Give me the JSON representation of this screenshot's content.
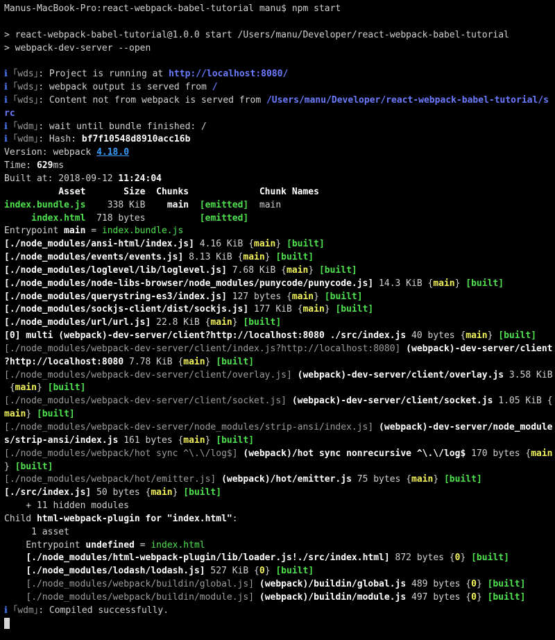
{
  "terminal": {
    "lines": [
      [
        {
          "t": "Manus-MacBook-Pro:react-webpack-babel-tutorial manu$ npm start"
        }
      ],
      [],
      [
        {
          "t": "> react-webpack-babel-tutorial@1.0.0 start /Users/manu/Developer/react-webpack-babel-tutorial"
        }
      ],
      [
        {
          "t": "> webpack-dev-server --open"
        }
      ],
      [],
      [
        {
          "t": "ℹ ",
          "c": "info"
        },
        {
          "t": "｢wds｣",
          "c": "dim"
        },
        {
          "t": ": Project is running at "
        },
        {
          "t": "http://localhost:8080/",
          "c": "bl"
        }
      ],
      [
        {
          "t": "ℹ ",
          "c": "info"
        },
        {
          "t": "｢wds｣",
          "c": "dim"
        },
        {
          "t": ": webpack output is served from "
        },
        {
          "t": "/",
          "c": "bl"
        }
      ],
      [
        {
          "t": "ℹ ",
          "c": "info"
        },
        {
          "t": "｢wds｣",
          "c": "dim"
        },
        {
          "t": ": Content not from webpack is served from "
        },
        {
          "t": "/Users/manu/Developer/react-webpack-babel-tutorial/s",
          "c": "bl"
        }
      ],
      [
        {
          "t": "rc",
          "c": "bl"
        }
      ],
      [
        {
          "t": "ℹ ",
          "c": "info"
        },
        {
          "t": "｢wdm｣",
          "c": "dim"
        },
        {
          "t": ": wait until bundle finished: /"
        }
      ],
      [
        {
          "t": "ℹ ",
          "c": "info"
        },
        {
          "t": "｢wdm｣",
          "c": "dim"
        },
        {
          "t": ": Hash: "
        },
        {
          "t": "bf7f10548d8910acc16b",
          "c": "w"
        }
      ],
      [
        {
          "t": "Version: webpack "
        },
        {
          "t": "4.18.0",
          "c": "ul"
        }
      ],
      [
        {
          "t": "Time: "
        },
        {
          "t": "629",
          "c": "w"
        },
        {
          "t": "ms"
        }
      ],
      [
        {
          "t": "Built at: 2018-09-12 "
        },
        {
          "t": "11:24:04",
          "c": "w"
        }
      ],
      [
        {
          "t": "          Asset       Size  Chunks             Chunk Names",
          "c": "w"
        }
      ],
      [
        {
          "t": "index.bundle.js",
          "c": "gb"
        },
        {
          "t": "    338 KiB    "
        },
        {
          "t": "main",
          "c": "w"
        },
        {
          "t": "  "
        },
        {
          "t": "[emitted]",
          "c": "gb"
        },
        {
          "t": "  main"
        }
      ],
      [
        {
          "t": "     "
        },
        {
          "t": "index.html",
          "c": "gb"
        },
        {
          "t": "  718 bytes          "
        },
        {
          "t": "[emitted]",
          "c": "gb"
        }
      ],
      [
        {
          "t": "Entrypoint "
        },
        {
          "t": "main",
          "c": "w"
        },
        {
          "t": " = "
        },
        {
          "t": "index.bundle.js",
          "c": "g"
        }
      ],
      [
        {
          "t": "[./node_modules/ansi-html/index.js]",
          "c": "w"
        },
        {
          "t": " 4.16 KiB {"
        },
        {
          "t": "main",
          "c": "y"
        },
        {
          "t": "} "
        },
        {
          "t": "[built]",
          "c": "gb"
        }
      ],
      [
        {
          "t": "[./node_modules/events/events.js]",
          "c": "w"
        },
        {
          "t": " 8.13 KiB {"
        },
        {
          "t": "main",
          "c": "y"
        },
        {
          "t": "} "
        },
        {
          "t": "[built]",
          "c": "gb"
        }
      ],
      [
        {
          "t": "[./node_modules/loglevel/lib/loglevel.js]",
          "c": "w"
        },
        {
          "t": " 7.68 KiB {"
        },
        {
          "t": "main",
          "c": "y"
        },
        {
          "t": "} "
        },
        {
          "t": "[built]",
          "c": "gb"
        }
      ],
      [
        {
          "t": "[./node_modules/node-libs-browser/node_modules/punycode/punycode.js]",
          "c": "w"
        },
        {
          "t": " 14.3 KiB {"
        },
        {
          "t": "main",
          "c": "y"
        },
        {
          "t": "} "
        },
        {
          "t": "[built]",
          "c": "gb"
        }
      ],
      [
        {
          "t": "[./node_modules/querystring-es3/index.js]",
          "c": "w"
        },
        {
          "t": " 127 bytes {"
        },
        {
          "t": "main",
          "c": "y"
        },
        {
          "t": "} "
        },
        {
          "t": "[built]",
          "c": "gb"
        }
      ],
      [
        {
          "t": "[./node_modules/sockjs-client/dist/sockjs.js]",
          "c": "w"
        },
        {
          "t": " 177 KiB {"
        },
        {
          "t": "main",
          "c": "y"
        },
        {
          "t": "} "
        },
        {
          "t": "[built]",
          "c": "gb"
        }
      ],
      [
        {
          "t": "[./node_modules/url/url.js]",
          "c": "w"
        },
        {
          "t": " 22.8 KiB {"
        },
        {
          "t": "main",
          "c": "y"
        },
        {
          "t": "} "
        },
        {
          "t": "[built]",
          "c": "gb"
        }
      ],
      [
        {
          "t": "[0] multi (webpack)-dev-server/client?http://localhost:8080 ./src/index.js",
          "c": "w"
        },
        {
          "t": " 40 bytes {"
        },
        {
          "t": "main",
          "c": "y"
        },
        {
          "t": "} "
        },
        {
          "t": "[built]",
          "c": "gb"
        }
      ],
      [
        {
          "t": "[./node_modules/webpack-dev-server/client/index.js?http://localhost:8080]",
          "c": "dim"
        },
        {
          "t": " (webpack)-dev-server/client",
          "c": "w"
        }
      ],
      [
        {
          "t": "?http://localhost:8080",
          "c": "w"
        },
        {
          "t": " 7.78 KiB {"
        },
        {
          "t": "main",
          "c": "y"
        },
        {
          "t": "} "
        },
        {
          "t": "[built]",
          "c": "gb"
        }
      ],
      [
        {
          "t": "[./node_modules/webpack-dev-server/client/overlay.js]",
          "c": "dim"
        },
        {
          "t": " (webpack)-dev-server/client/overlay.js",
          "c": "w"
        },
        {
          "t": " 3.58 KiB"
        }
      ],
      [
        {
          "t": " {"
        },
        {
          "t": "main",
          "c": "y"
        },
        {
          "t": "} "
        },
        {
          "t": "[built]",
          "c": "gb"
        }
      ],
      [
        {
          "t": "[./node_modules/webpack-dev-server/client/socket.js]",
          "c": "dim"
        },
        {
          "t": " (webpack)-dev-server/client/socket.js",
          "c": "w"
        },
        {
          "t": " 1.05 KiB {"
        }
      ],
      [
        {
          "t": "main",
          "c": "y"
        },
        {
          "t": "} "
        },
        {
          "t": "[built]",
          "c": "gb"
        }
      ],
      [
        {
          "t": "[./node_modules/webpack-dev-server/node_modules/strip-ansi/index.js]",
          "c": "dim"
        },
        {
          "t": " (webpack)-dev-server/node_module",
          "c": "w"
        }
      ],
      [
        {
          "t": "s/strip-ansi/index.js",
          "c": "w"
        },
        {
          "t": " 161 bytes {"
        },
        {
          "t": "main",
          "c": "y"
        },
        {
          "t": "} "
        },
        {
          "t": "[built]",
          "c": "gb"
        }
      ],
      [
        {
          "t": "[./node_modules/webpack/hot sync ^\\.\\/log$]",
          "c": "dim"
        },
        {
          "t": " (webpack)/hot sync nonrecursive ^\\.\\/log$",
          "c": "w"
        },
        {
          "t": " 170 bytes {"
        },
        {
          "t": "main",
          "c": "y"
        }
      ],
      [
        {
          "t": "} "
        },
        {
          "t": "[built]",
          "c": "gb"
        }
      ],
      [
        {
          "t": "[./node_modules/webpack/hot/emitter.js]",
          "c": "dim"
        },
        {
          "t": " (webpack)/hot/emitter.js",
          "c": "w"
        },
        {
          "t": " 75 bytes {"
        },
        {
          "t": "main",
          "c": "y"
        },
        {
          "t": "} "
        },
        {
          "t": "[built]",
          "c": "gb"
        }
      ],
      [
        {
          "t": "[./src/index.js]",
          "c": "w"
        },
        {
          "t": " 50 bytes {"
        },
        {
          "t": "main",
          "c": "y"
        },
        {
          "t": "} "
        },
        {
          "t": "[built]",
          "c": "gb"
        }
      ],
      [
        {
          "t": "    + 11 hidden modules"
        }
      ],
      [
        {
          "t": "Child "
        },
        {
          "t": "html-webpack-plugin for \"index.html\"",
          "c": "w"
        },
        {
          "t": ":"
        }
      ],
      [
        {
          "t": "     1 asset"
        }
      ],
      [
        {
          "t": "    Entrypoint "
        },
        {
          "t": "undefined",
          "c": "w"
        },
        {
          "t": " = "
        },
        {
          "t": "index.html",
          "c": "g"
        }
      ],
      [
        {
          "t": "    "
        },
        {
          "t": "[./node_modules/html-webpack-plugin/lib/loader.js!./src/index.html]",
          "c": "w"
        },
        {
          "t": " 872 bytes {"
        },
        {
          "t": "0",
          "c": "y"
        },
        {
          "t": "} "
        },
        {
          "t": "[built]",
          "c": "gb"
        }
      ],
      [
        {
          "t": "    "
        },
        {
          "t": "[./node_modules/lodash/lodash.js]",
          "c": "w"
        },
        {
          "t": " 527 KiB {"
        },
        {
          "t": "0",
          "c": "y"
        },
        {
          "t": "} "
        },
        {
          "t": "[built]",
          "c": "gb"
        }
      ],
      [
        {
          "t": "    "
        },
        {
          "t": "[./node_modules/webpack/buildin/global.js]",
          "c": "dim"
        },
        {
          "t": " (webpack)/buildin/global.js",
          "c": "w"
        },
        {
          "t": " 489 bytes {"
        },
        {
          "t": "0",
          "c": "y"
        },
        {
          "t": "} "
        },
        {
          "t": "[built]",
          "c": "gb"
        }
      ],
      [
        {
          "t": "    "
        },
        {
          "t": "[./node_modules/webpack/buildin/module.js]",
          "c": "dim"
        },
        {
          "t": " (webpack)/buildin/module.js",
          "c": "w"
        },
        {
          "t": " 497 bytes {"
        },
        {
          "t": "0",
          "c": "y"
        },
        {
          "t": "} "
        },
        {
          "t": "[built]",
          "c": "gb"
        }
      ],
      [
        {
          "t": "ℹ ",
          "c": "info"
        },
        {
          "t": "｢wdm｣",
          "c": "dim"
        },
        {
          "t": ": Compiled successfully."
        }
      ]
    ]
  }
}
